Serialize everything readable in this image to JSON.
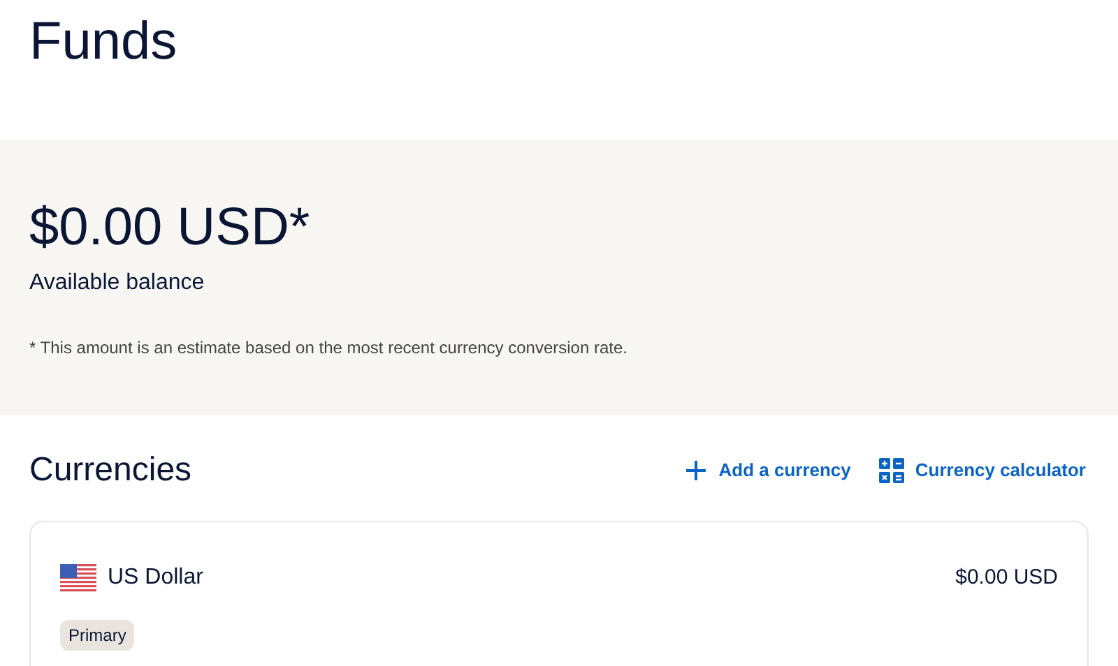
{
  "page_title": "Funds",
  "balance": {
    "amount": "$0.00 USD*",
    "label": "Available balance",
    "note": "* This amount is an estimate based on the most recent currency conversion rate."
  },
  "currencies": {
    "title": "Currencies",
    "actions": [
      {
        "kind": "add",
        "label": "Add a currency"
      },
      {
        "kind": "calculator",
        "label": "Currency calculator"
      }
    ],
    "items": [
      {
        "name": "US Dollar",
        "amount": "$0.00 USD",
        "badge": "Primary"
      }
    ]
  }
}
